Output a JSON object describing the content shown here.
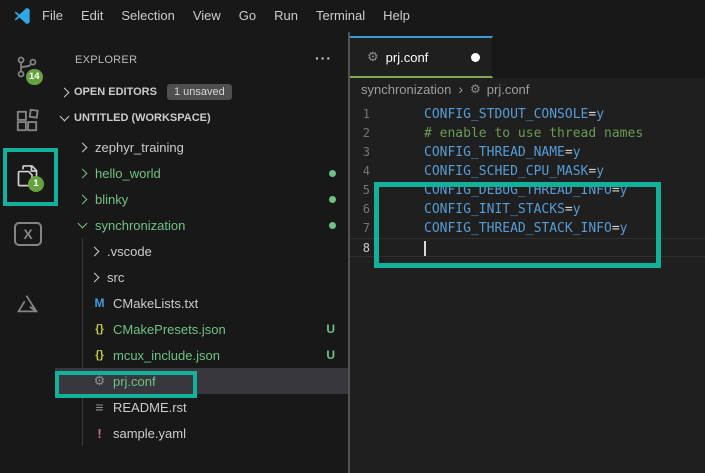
{
  "colors": {
    "annotation_teal": "#12b19c",
    "git_green": "#6fc287",
    "config_blue": "#569cd6",
    "comment_green": "#6a9955",
    "tab_border_top_blue": "#3c9cd7",
    "tab_border_bottom_green": "#85a854",
    "badge_green": "#65a33f",
    "selected_row": "#37373d"
  },
  "menu": {
    "items": [
      "File",
      "Edit",
      "Selection",
      "View",
      "Go",
      "Run",
      "Terminal",
      "Help"
    ]
  },
  "activity_bar": {
    "source_control_badge": "14",
    "explorer_badge": "1",
    "x_label": "X"
  },
  "sidebar": {
    "title": "EXPLORER",
    "more_actions": "···",
    "open_editors": {
      "label": "OPEN EDITORS",
      "badge": "1 unsaved"
    },
    "workspace_label": "UNTITLED (WORKSPACE)",
    "tree": [
      {
        "label": "zephyr_training"
      },
      {
        "label": "hello_world"
      },
      {
        "label": "blinky"
      },
      {
        "label": "synchronization"
      },
      {
        "label": ".vscode"
      },
      {
        "label": "src"
      },
      {
        "label": "CMakeLists.txt",
        "icon_text": "M"
      },
      {
        "label": "CMakePresets.json",
        "icon_text": "{}",
        "badge": "U"
      },
      {
        "label": "mcux_include.json",
        "icon_text": "{}",
        "badge": "U"
      },
      {
        "label": "prj.conf",
        "icon_text": "⚙"
      },
      {
        "label": "README.rst",
        "icon_text": "≡"
      },
      {
        "label": "sample.yaml",
        "icon_text": "!"
      }
    ]
  },
  "editor": {
    "tab": {
      "label": "prj.conf",
      "gear": "⚙"
    },
    "breadcrumb": {
      "folder": "synchronization",
      "separator": "›",
      "gear": "⚙",
      "file": "prj.conf"
    },
    "lines": [
      {
        "num": "1",
        "name": "CONFIG_STDOUT_CONSOLE",
        "op": "=",
        "val": "y"
      },
      {
        "num": "2",
        "comment": "# enable to use thread names"
      },
      {
        "num": "3",
        "name": "CONFIG_THREAD_NAME",
        "op": "=",
        "val": "y"
      },
      {
        "num": "4",
        "name": "CONFIG_SCHED_CPU_MASK",
        "op": "=",
        "val": "y"
      },
      {
        "num": "5",
        "name": "CONFIG_DEBUG_THREAD_INFO",
        "op": "=",
        "val": "y"
      },
      {
        "num": "6",
        "name": "CONFIG_INIT_STACKS",
        "op": "=",
        "val": "y"
      },
      {
        "num": "7",
        "name": "CONFIG_THREAD_STACK_INFO",
        "op": "=",
        "val": "y"
      },
      {
        "num": "8"
      }
    ]
  }
}
